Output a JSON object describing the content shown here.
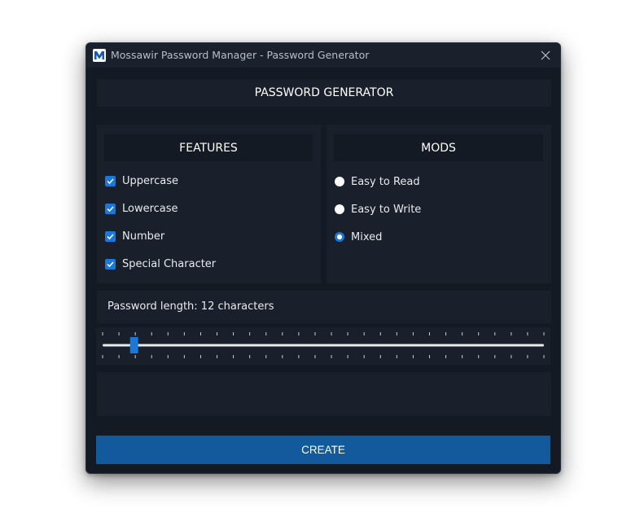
{
  "window": {
    "title": "Mossawir Password Manager - Password Generator"
  },
  "header": {
    "title": "PASSWORD GENERATOR"
  },
  "features": {
    "title": "FEATURES",
    "items": [
      {
        "label": "Uppercase",
        "checked": true
      },
      {
        "label": "Lowercase",
        "checked": true
      },
      {
        "label": "Number",
        "checked": true
      },
      {
        "label": "Special Character",
        "checked": true
      }
    ]
  },
  "mods": {
    "title": "MODS",
    "items": [
      {
        "label": "Easy to Read",
        "selected": false
      },
      {
        "label": "Easy to Write",
        "selected": false
      },
      {
        "label": "Mixed",
        "selected": true
      }
    ]
  },
  "length": {
    "label": "Password length: 12 characters",
    "value": 12,
    "min": 8,
    "max": 64,
    "ticks": 28
  },
  "output": {
    "value": ""
  },
  "create": {
    "label": "CREATE"
  },
  "colors": {
    "accent": "#1a78d8",
    "button": "#135a9c",
    "window_bg": "#141a24",
    "panel_bg": "#1a202b"
  }
}
